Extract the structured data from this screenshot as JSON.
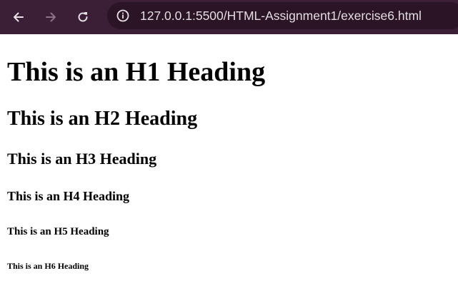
{
  "browser": {
    "url": "127.0.0.1:5500/HTML-Assignment1/exercise6.html",
    "colors": {
      "toolbar_bg": "#3b1f36",
      "address_bg": "#2a1426",
      "url_text": "#e3dde1",
      "icon_active": "#e8e2e6",
      "icon_disabled": "#8a7386"
    },
    "icons": {
      "back": "back-arrow-icon",
      "forward": "forward-arrow-icon",
      "reload": "reload-icon",
      "site_info": "info-icon"
    }
  },
  "page": {
    "headings": {
      "h1": "This is an H1 Heading",
      "h2": "This is an H2 Heading",
      "h3": "This is an H3 Heading",
      "h4": "This is an H4 Heading",
      "h5": "This is an H5 Heading",
      "h6": "This is an H6 Heading"
    }
  }
}
